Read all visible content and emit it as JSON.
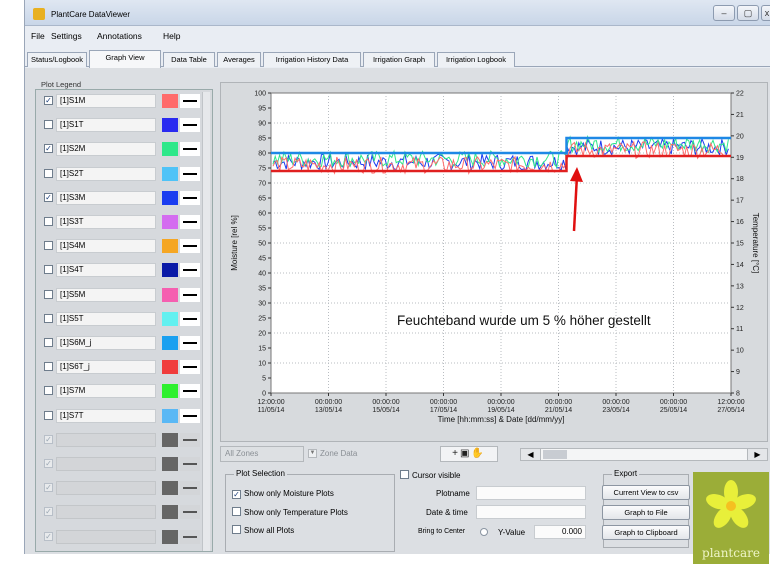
{
  "window": {
    "title": "PlantCare DataViewer",
    "controls": [
      "–",
      "▢",
      "x"
    ]
  },
  "menu": [
    "File",
    "Settings",
    "Annotations",
    "Help"
  ],
  "tabs": [
    "Status/Logbook",
    "Graph View",
    "Data Table",
    "Averages",
    "Irrigation History Data",
    "Irrigation Graph",
    "Irrigation Logbook"
  ],
  "active_tab": "Graph View",
  "legend": {
    "title": "Plot Legend",
    "items": [
      {
        "label": "[1]S1M",
        "checked": true,
        "color": "#ff6b6b"
      },
      {
        "label": "[1]S1T",
        "checked": false,
        "color": "#2a2af0"
      },
      {
        "label": "[1]S2M",
        "checked": true,
        "color": "#2ee88a"
      },
      {
        "label": "[1]S2T",
        "checked": false,
        "color": "#4fc3f7"
      },
      {
        "label": "[1]S3M",
        "checked": true,
        "color": "#1a3cf0"
      },
      {
        "label": "[1]S3T",
        "checked": false,
        "color": "#d46cf0"
      },
      {
        "label": "[1]S4M",
        "checked": false,
        "color": "#f5a623"
      },
      {
        "label": "[1]S4T",
        "checked": false,
        "color": "#0a1aa8"
      },
      {
        "label": "[1]S5M",
        "checked": false,
        "color": "#f55fb0"
      },
      {
        "label": "[1]S5T",
        "checked": false,
        "color": "#62f0f0"
      },
      {
        "label": "[1]S6M_j",
        "checked": false,
        "color": "#1aa0f0"
      },
      {
        "label": "[1]S6T_j",
        "checked": false,
        "color": "#f03c3c"
      },
      {
        "label": "[1]S7M",
        "checked": false,
        "color": "#2ef02e"
      },
      {
        "label": "[1]S7T",
        "checked": false,
        "color": "#5ab8f5"
      },
      {
        "label": "",
        "checked": true,
        "disabled": true,
        "color": "#666666"
      },
      {
        "label": "",
        "checked": true,
        "disabled": true,
        "color": "#666666"
      },
      {
        "label": "",
        "checked": true,
        "disabled": true,
        "color": "#666666"
      },
      {
        "label": "",
        "checked": true,
        "disabled": true,
        "color": "#666666"
      },
      {
        "label": "",
        "checked": true,
        "disabled": true,
        "color": "#666666"
      }
    ]
  },
  "chart_data": {
    "type": "line",
    "xlabel": "Time [hh:mm:ss] & Date [dd/mm/yy]",
    "ylabel": "Moisture [rel %]",
    "y2label": "Temperature [°C]",
    "ylim": [
      0,
      100
    ],
    "y2lim": [
      8,
      22
    ],
    "yticks": [
      0,
      5,
      10,
      15,
      20,
      25,
      30,
      35,
      40,
      45,
      50,
      55,
      60,
      65,
      70,
      75,
      80,
      85,
      90,
      95,
      100
    ],
    "y2ticks": [
      8,
      9,
      10,
      11,
      12,
      13,
      14,
      15,
      16,
      17,
      18,
      19,
      20,
      21,
      22
    ],
    "xticks": [
      {
        "time": "12:00:00",
        "date": "11/05/14"
      },
      {
        "time": "00:00:00",
        "date": "13/05/14"
      },
      {
        "time": "00:00:00",
        "date": "15/05/14"
      },
      {
        "time": "00:00:00",
        "date": "17/05/14"
      },
      {
        "time": "00:00:00",
        "date": "19/05/14"
      },
      {
        "time": "00:00:00",
        "date": "21/05/14"
      },
      {
        "time": "00:00:00",
        "date": "23/05/14"
      },
      {
        "time": "00:00:00",
        "date": "25/05/14"
      },
      {
        "time": "12:00:00",
        "date": "27/05/14"
      }
    ],
    "grid": true,
    "band_upper": {
      "before": 80,
      "after": 85,
      "color": "#1e88e5"
    },
    "band_lower": {
      "before": 74,
      "after": 79,
      "color": "#e02020"
    },
    "step_date": "21/05/14",
    "series": [
      {
        "color": "#1a3cf0",
        "level_before": 77,
        "level_after": 82
      },
      {
        "color": "#2ee88a",
        "level_before": 78,
        "level_after": 83
      },
      {
        "color": "#ff6b6b",
        "level_before": 76,
        "level_after": 81
      }
    ],
    "annotation": "Feuchteband wurde um 5 % höher gestellt"
  },
  "controls": {
    "zone_select": "All Zones",
    "zone_data": "Zone Data",
    "plot_tools": "+▣✋"
  },
  "plot_selection": {
    "title": "Plot Selection",
    "options": [
      {
        "label": "Show only Moisture Plots",
        "checked": true
      },
      {
        "label": "Show only Temperature Plots",
        "checked": false
      },
      {
        "label": "Show all Plots",
        "checked": false
      }
    ]
  },
  "cursor": {
    "title": "Cursor visible",
    "plotname_label": "Plotname",
    "datetime_label": "Date & time",
    "bring_to_center": "Bring to Center",
    "y_value_label": "Y-Value",
    "y_value": "0.000"
  },
  "export": {
    "title": "Export",
    "buttons": [
      "Current View to csv",
      "Graph to File",
      "Graph to Clipboard"
    ]
  },
  "logo": {
    "text": "plantcare",
    "color": "#9bad38"
  }
}
